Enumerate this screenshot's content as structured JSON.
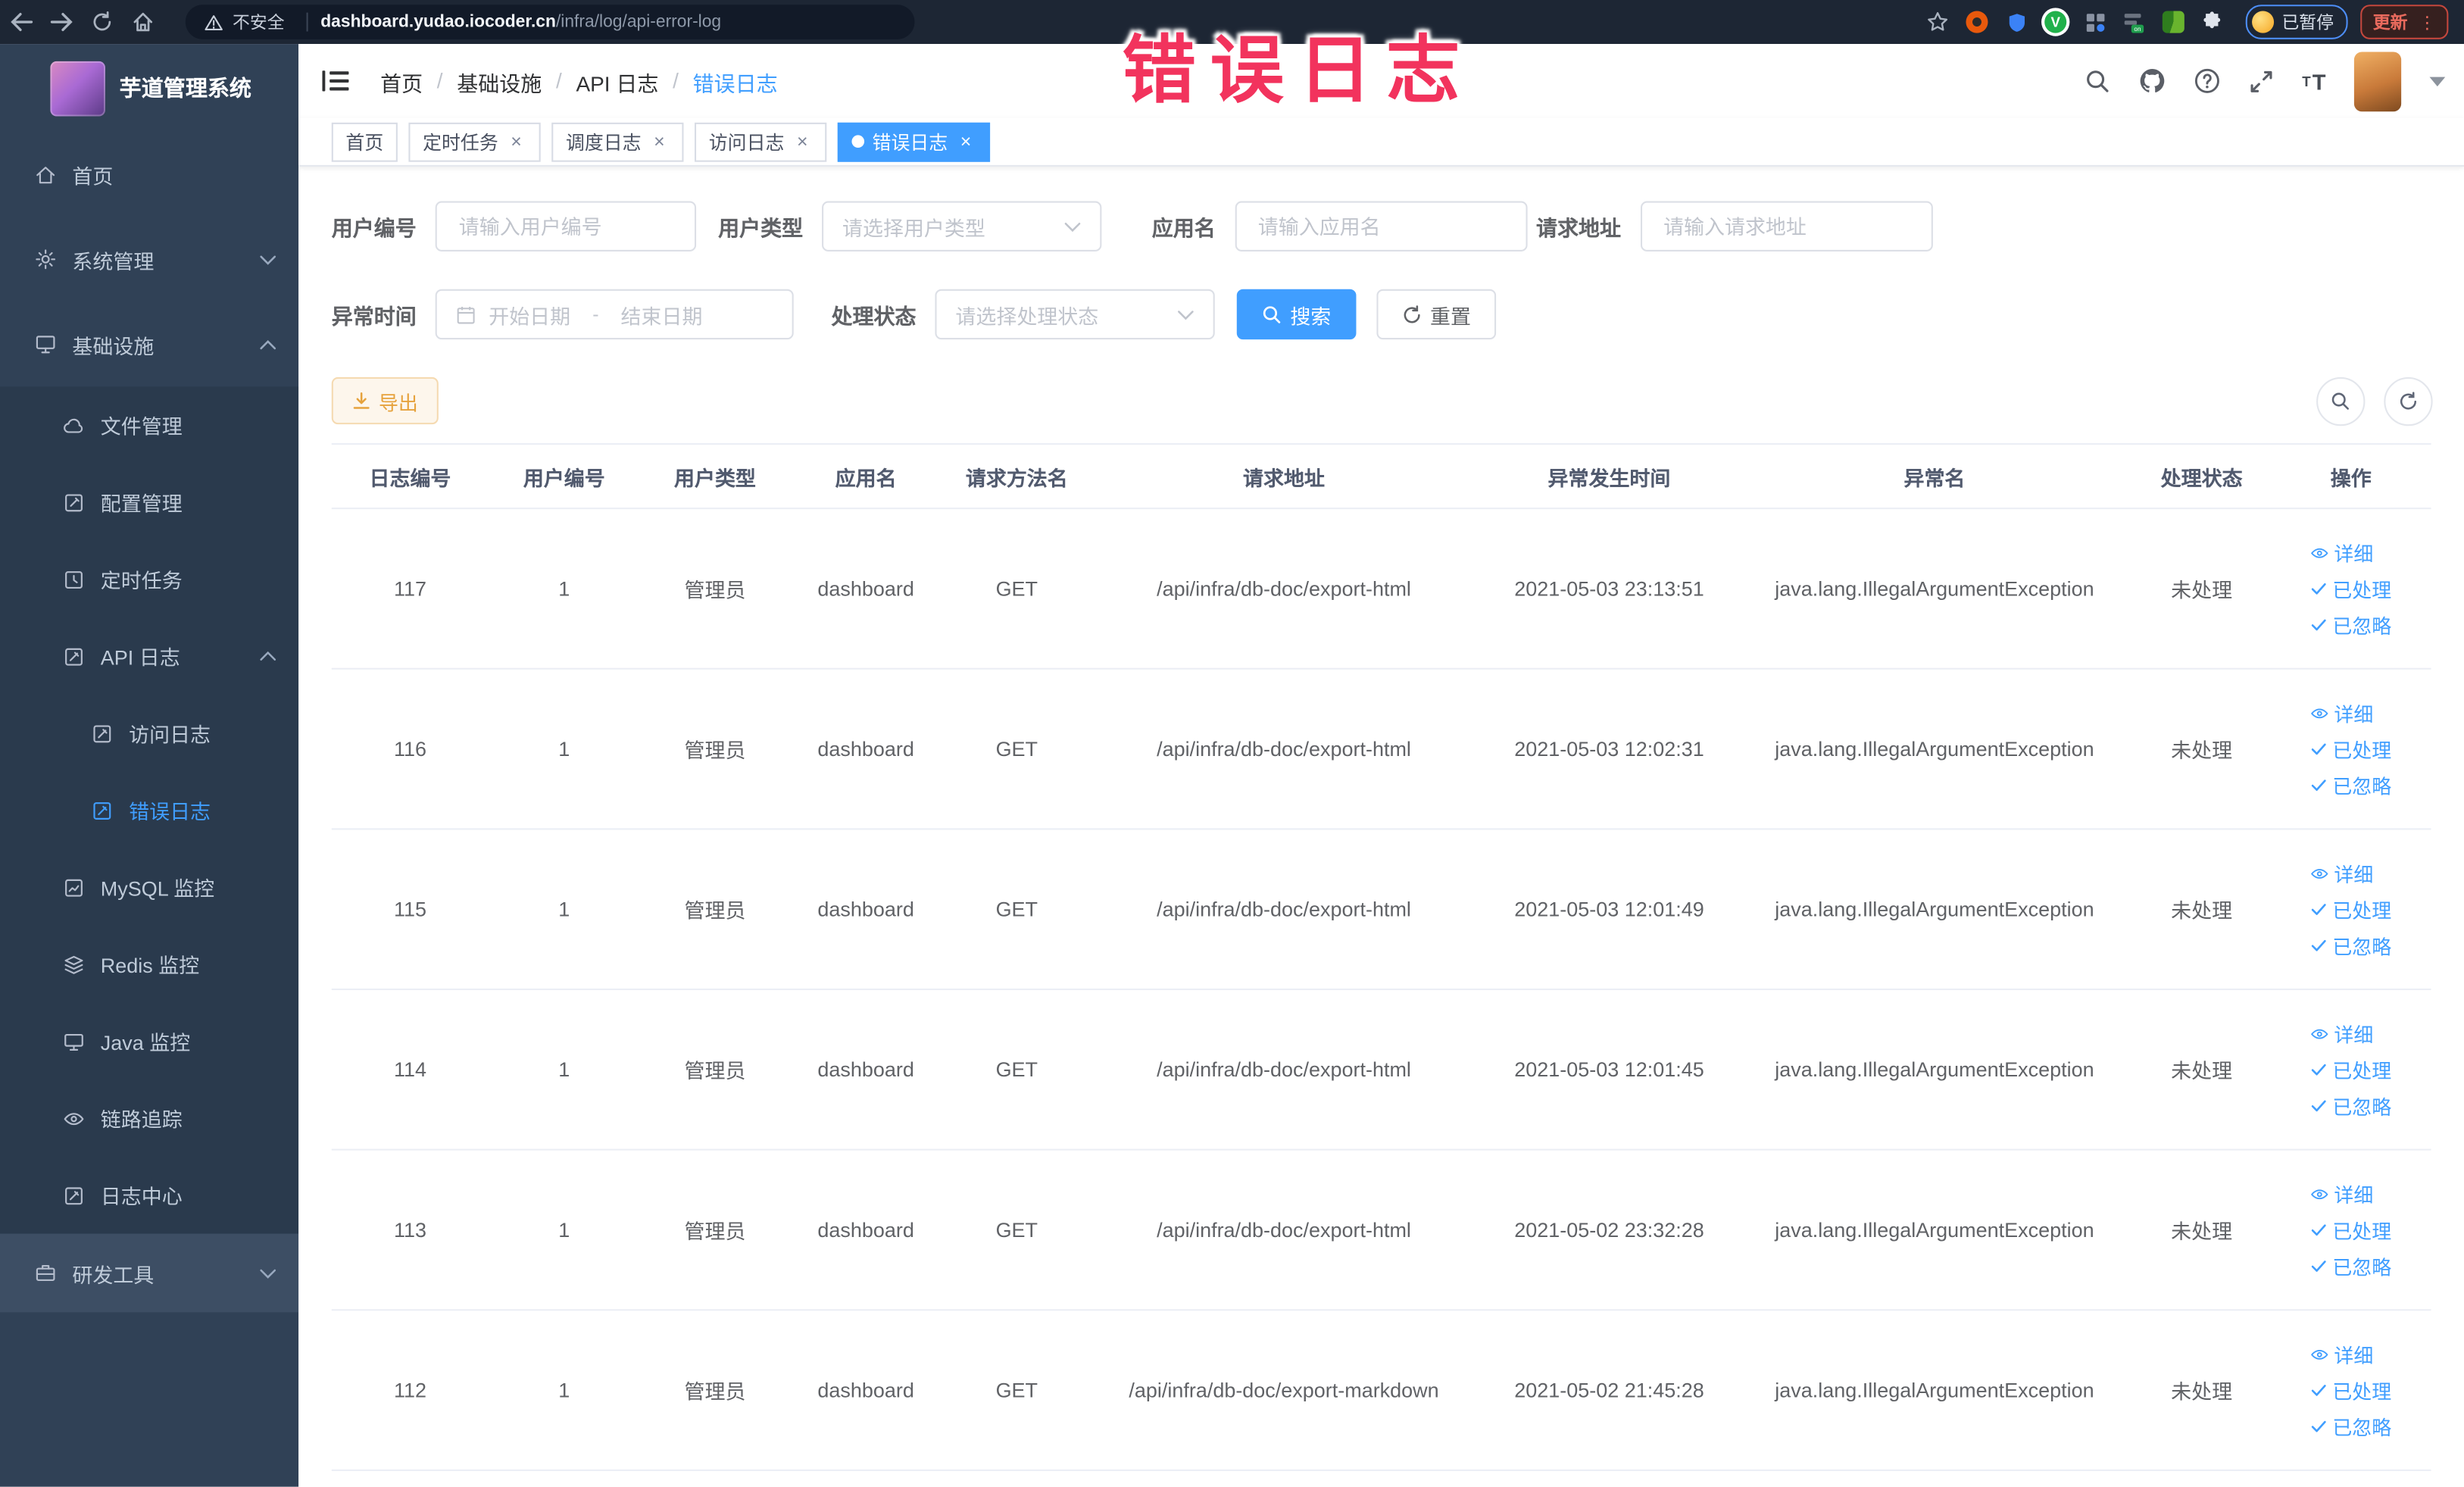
{
  "browser": {
    "security_label": "不安全",
    "url_host": "dashboard.yudao.iocoder.cn",
    "url_path": "/infra/log/api-error-log",
    "paused_badge": "已暂停",
    "update_button": "更新",
    "kebab": "⋮"
  },
  "overlay": {
    "text": "错误日志"
  },
  "sidebar": {
    "title": "芋道管理系统",
    "items": {
      "home": "首页",
      "system": "系统管理",
      "infra": "基础设施",
      "file": "文件管理",
      "config": "配置管理",
      "job": "定时任务",
      "api_log": "API 日志",
      "access_log": "访问日志",
      "error_log": "错误日志",
      "mysql": "MySQL 监控",
      "redis": "Redis 监控",
      "java": "Java 监控",
      "trace": "链路追踪",
      "log_center": "日志中心",
      "dev_tools": "研发工具"
    }
  },
  "header": {
    "breadcrumb": [
      "首页",
      "基础设施",
      "API 日志",
      "错误日志"
    ],
    "separator": "/"
  },
  "tabs": [
    {
      "label": "首页"
    },
    {
      "label": "定时任务"
    },
    {
      "label": "调度日志"
    },
    {
      "label": "访问日志"
    },
    {
      "label": "错误日志"
    }
  ],
  "filters": {
    "user_id": {
      "label": "用户编号",
      "placeholder": "请输入用户编号"
    },
    "user_type": {
      "label": "用户类型",
      "placeholder": "请选择用户类型"
    },
    "app_name": {
      "label": "应用名",
      "placeholder": "请输入应用名"
    },
    "req_url": {
      "label": "请求地址",
      "placeholder": "请输入请求地址"
    },
    "exc_time": {
      "label": "异常时间",
      "start_placeholder": "开始日期",
      "separator": "-",
      "end_placeholder": "结束日期"
    },
    "status": {
      "label": "处理状态",
      "placeholder": "请选择处理状态"
    },
    "search_button": "搜索",
    "reset_button": "重置"
  },
  "toolbar": {
    "export_label": "导出"
  },
  "table": {
    "columns": [
      "日志编号",
      "用户编号",
      "用户类型",
      "应用名",
      "请求方法名",
      "请求地址",
      "异常发生时间",
      "异常名",
      "处理状态",
      "操作"
    ],
    "action_labels": [
      "详细",
      "已处理",
      "已忽略"
    ],
    "rows": [
      {
        "id": "117",
        "user_id": "1",
        "user_type": "管理员",
        "app": "dashboard",
        "method": "GET",
        "url": "/api/infra/db-doc/export-html",
        "time": "2021-05-03 23:13:51",
        "exception": "java.lang.IllegalArgumentException",
        "status": "未处理"
      },
      {
        "id": "116",
        "user_id": "1",
        "user_type": "管理员",
        "app": "dashboard",
        "method": "GET",
        "url": "/api/infra/db-doc/export-html",
        "time": "2021-05-03 12:02:31",
        "exception": "java.lang.IllegalArgumentException",
        "status": "未处理"
      },
      {
        "id": "115",
        "user_id": "1",
        "user_type": "管理员",
        "app": "dashboard",
        "method": "GET",
        "url": "/api/infra/db-doc/export-html",
        "time": "2021-05-03 12:01:49",
        "exception": "java.lang.IllegalArgumentException",
        "status": "未处理"
      },
      {
        "id": "114",
        "user_id": "1",
        "user_type": "管理员",
        "app": "dashboard",
        "method": "GET",
        "url": "/api/infra/db-doc/export-html",
        "time": "2021-05-03 12:01:45",
        "exception": "java.lang.IllegalArgumentException",
        "status": "未处理"
      },
      {
        "id": "113",
        "user_id": "1",
        "user_type": "管理员",
        "app": "dashboard",
        "method": "GET",
        "url": "/api/infra/db-doc/export-html",
        "time": "2021-05-02 23:32:28",
        "exception": "java.lang.IllegalArgumentException",
        "status": "未处理"
      },
      {
        "id": "112",
        "user_id": "1",
        "user_type": "管理员",
        "app": "dashboard",
        "method": "GET",
        "url": "/api/infra/db-doc/export-markdown",
        "time": "2021-05-02 21:45:28",
        "exception": "java.lang.IllegalArgumentException",
        "status": "未处理"
      }
    ]
  },
  "colors": {
    "accent": "#409eff",
    "warning": "#e6a23c",
    "overlay_red": "#f2335d",
    "sidebar_bg": "#304156"
  }
}
